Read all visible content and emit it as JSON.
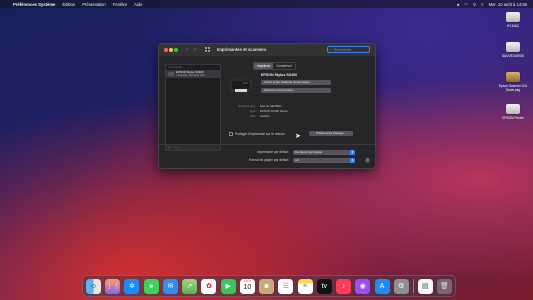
{
  "menubar": {
    "apple": "",
    "app": "Préférences Système",
    "menus": [
      "Édition",
      "Présentation",
      "Fenêtre",
      "Aide"
    ],
    "datetime": "Mer. 10 août à  14:55"
  },
  "desktop": {
    "icons": [
      "HY-MAC",
      "SAUVEGARDE",
      "Epson Scanner ICA Driver.pkg",
      "EPSON Printer"
    ]
  },
  "window": {
    "title": "Imprimantes et scanners",
    "search_placeholder": "Rechercher",
    "list_header": "Imprimantes",
    "printer_name": "EPSON Stylus SX400",
    "printer_status": "• Inactive, dernière utili...",
    "tabs": [
      "Imprimer",
      "Numériser"
    ],
    "active_tab": "Imprimer",
    "detail_title": "EPSON Stylus SX400",
    "btn_queue": "Ouvrir la file d'attente d'impression...",
    "btn_options": "Options et fournitures...",
    "info_labels": [
      "Emplacement :",
      "Type :",
      "État :"
    ],
    "info_values": [
      "Mac de SEUBSO",
      "EPSON SX400 Series",
      "Inactive"
    ],
    "share_label": "Partager l'imprimante sur le réseau",
    "share_button": "Préférences Partage...",
    "default_printer_label": "Imprimante par défaut :",
    "default_printer_value": "Dernière imprimante",
    "paper_label": "Format de papier par défaut :",
    "paper_value": "A4",
    "help": "?"
  },
  "dock": {
    "apps": [
      "Finder",
      "Launchpad",
      "Safari",
      "Messages",
      "Mail",
      "Plans",
      "Photos",
      "FaceTime",
      "Calendrier",
      "Contacts",
      "Rappels",
      "Notes",
      "TV",
      "Musique",
      "Podcasts",
      "App Store",
      "Préférences Système",
      "Document",
      "Corbeille"
    ],
    "calendar_month": "AOÛT",
    "calendar_day": "10"
  },
  "colors": {
    "accent": "#3b82f6"
  }
}
